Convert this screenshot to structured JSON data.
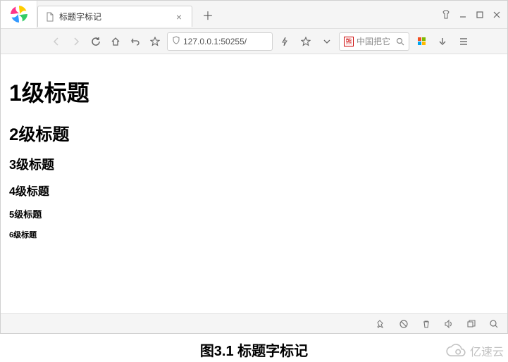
{
  "tab": {
    "title": "标题字标记"
  },
  "url": "127.0.0.1:50255/",
  "search": {
    "placeholder": "中国把它"
  },
  "headings": {
    "h1": "1级标题",
    "h2": "2级标题",
    "h3": "3级标题",
    "h4": "4级标题",
    "h5": "5级标题",
    "h6": "6级标题"
  },
  "caption": "图3.1 标题字标记",
  "watermark": "亿速云"
}
